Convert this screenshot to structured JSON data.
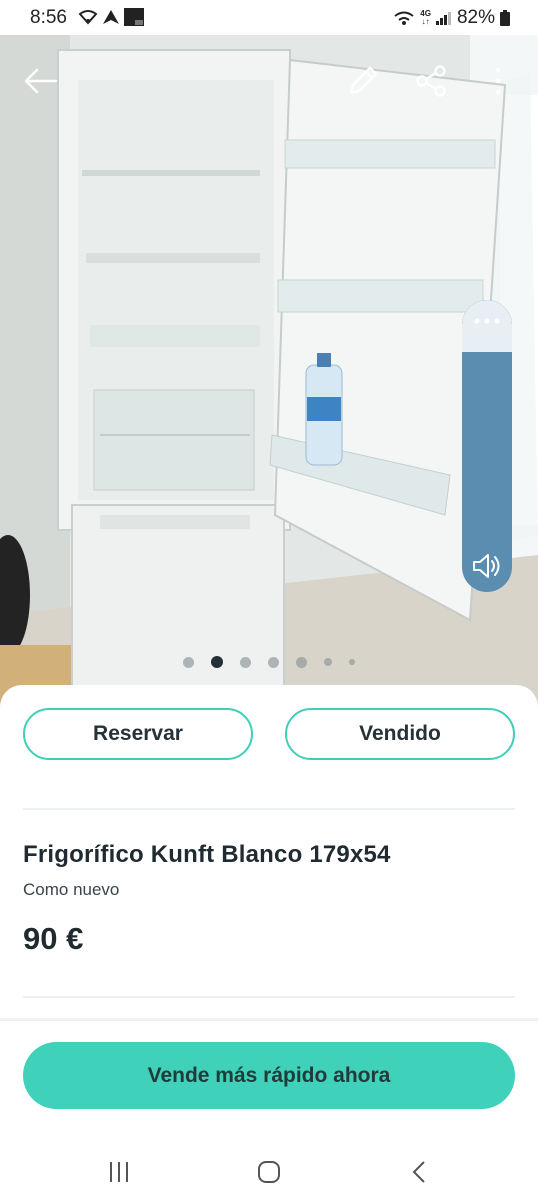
{
  "status_bar": {
    "time": "8:56",
    "network_badge": "4G",
    "battery": "82%"
  },
  "photo": {
    "icons": [
      "back-arrow-icon",
      "edit-pencil-icon",
      "share-icon",
      "more-vertical-icon"
    ],
    "carousel": {
      "count": 7,
      "active_index": 1
    }
  },
  "volume_panel": {
    "icons": [
      "more-horizontal-icon",
      "speaker-icon"
    ],
    "level": 0.85
  },
  "actions": {
    "reserve_label": "Reservar",
    "sold_label": "Vendido"
  },
  "listing": {
    "title": "Frigorífico Kunft Blanco 179x54",
    "condition": "Como nuevo",
    "price": "90 €"
  },
  "promote": {
    "label": "Vende más rápido ahora"
  },
  "colors": {
    "accent": "#3fd1b9",
    "text": "#1f2b30",
    "volume": "#5b8db1"
  },
  "nav": {
    "icons": [
      "recents-icon",
      "home-icon",
      "back-icon"
    ]
  }
}
